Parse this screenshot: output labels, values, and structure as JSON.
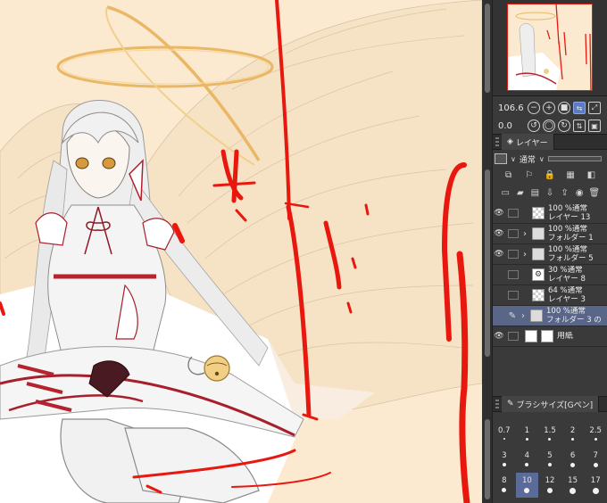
{
  "navigator": {
    "zoom_value": "106.6",
    "rotate_value": "0.0",
    "zoom_out_icon": "minus-circle-icon",
    "zoom_in_icon": "plus-circle-icon",
    "fit_icon": "stop-square-icon",
    "flip_icon": "flip-horizontal-icon",
    "fullscreen_icon": "expand-icon",
    "rotate_left_icon": "rotate-left-icon",
    "rotate_reset_icon": "reset-rotation-icon",
    "rotate_right_icon": "rotate-right-icon"
  },
  "layer_panel": {
    "tab_label": "レイヤー",
    "blend_mode": "通常"
  },
  "layers": [
    {
      "opacity": "100 %通常",
      "name": "レイヤー 13",
      "type": "raster",
      "visible": true
    },
    {
      "opacity": "100 %通常",
      "name": "フォルダー 1",
      "type": "folder",
      "visible": true
    },
    {
      "opacity": "100 %通常",
      "name": "フォルダー 5",
      "type": "folder",
      "visible": true
    },
    {
      "opacity": "30 %通常",
      "name": "レイヤー 8",
      "type": "tone",
      "visible": false
    },
    {
      "opacity": "64 %通常",
      "name": "レイヤー 3",
      "type": "raster",
      "visible": false
    },
    {
      "opacity": "100 %通常",
      "name": "フォルダー 3 の",
      "type": "folder",
      "visible": false,
      "selected": true
    },
    {
      "opacity": "",
      "name": "用紙",
      "type": "paper",
      "visible": true
    }
  ],
  "brush_panel": {
    "tab_label": "ブラシサイズ[Gペン]",
    "sizes": [
      "0.7",
      "1",
      "1.5",
      "2",
      "2.5",
      "3",
      "4",
      "5",
      "6",
      "7",
      "8",
      "10",
      "12",
      "15",
      "17"
    ],
    "selected": "10"
  },
  "colors": {
    "canvas_bg": "#fbe9d0",
    "accent_red": "#e8180f",
    "selected_row": "#5a6687",
    "panel_bg": "#3a3a3a"
  }
}
